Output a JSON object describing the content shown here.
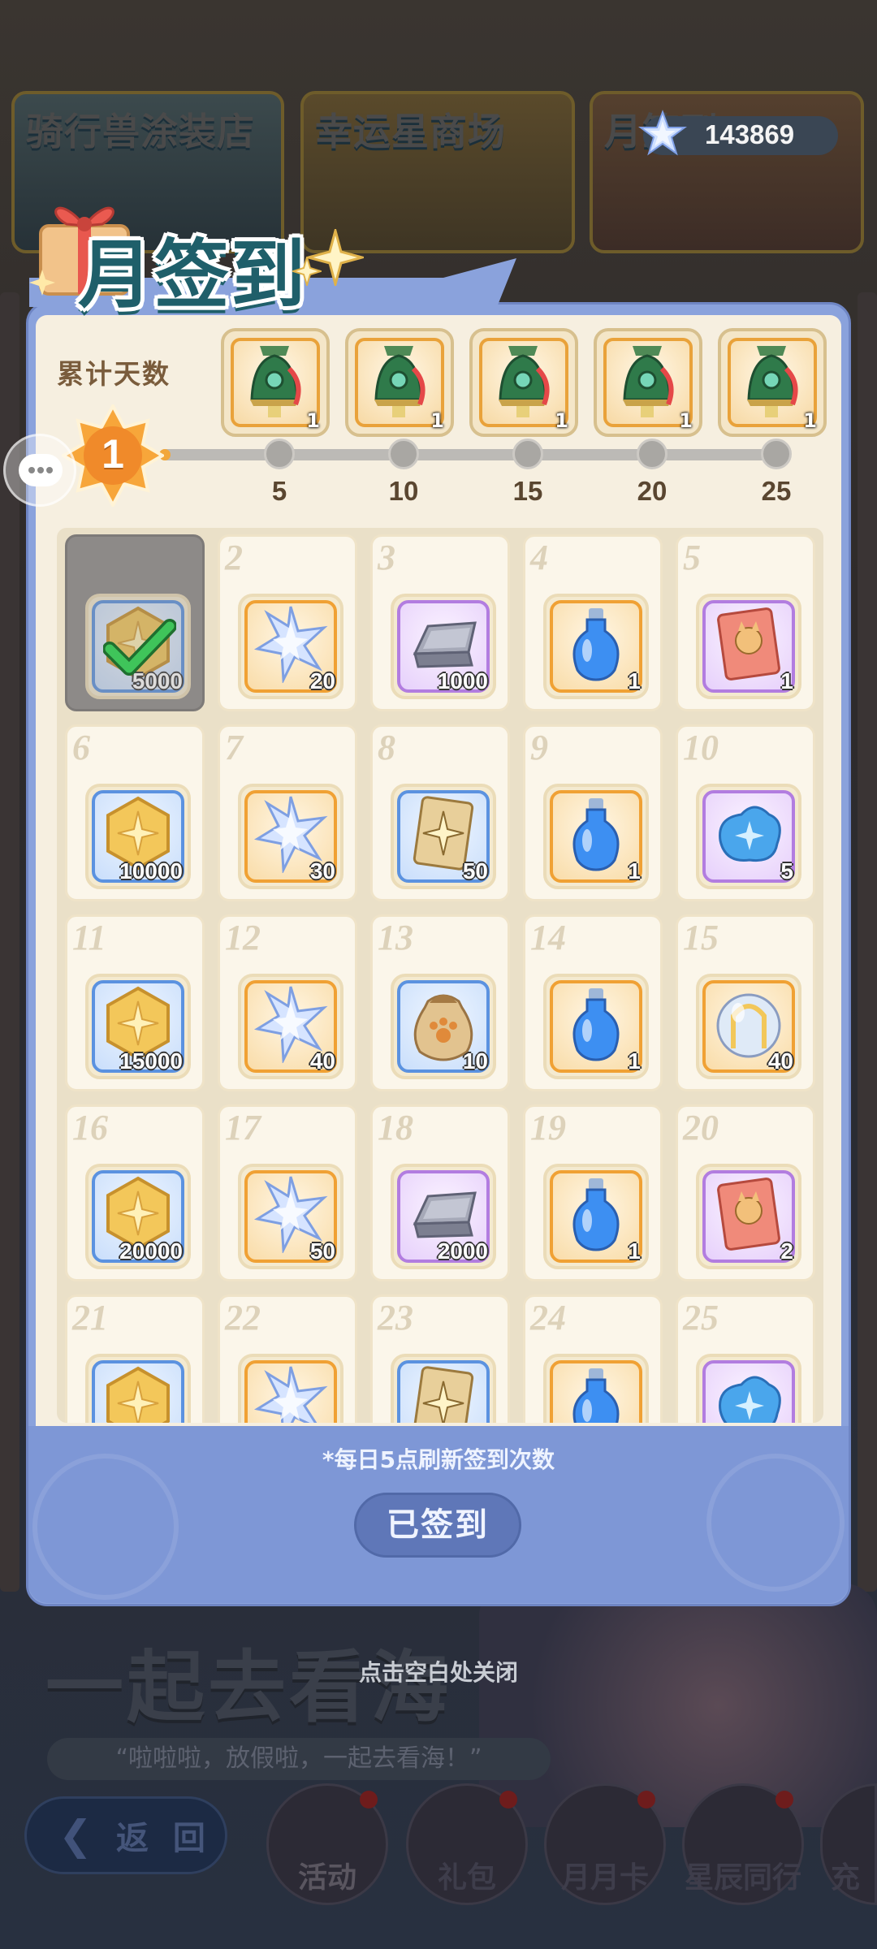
{
  "background": {
    "shops": [
      {
        "label": "骑行兽涂装店"
      },
      {
        "label": "幸运星商场"
      },
      {
        "label": "月签到"
      }
    ],
    "currency": {
      "icon": "star-crystal-icon",
      "amount": "143869"
    },
    "banner_title": "一起去看海",
    "banner_subtitle": "“啦啦啦，放假啦，一起去看海！”",
    "back_label": "返 回",
    "nav": [
      {
        "label": "活动"
      },
      {
        "label": "礼包"
      },
      {
        "label": "月月卡"
      },
      {
        "label": "星辰同行"
      },
      {
        "label": "充"
      }
    ]
  },
  "modal": {
    "title": "月签到",
    "cumulative_label": "累计天数",
    "cumulative_days": "1",
    "milestones": [
      {
        "day": "5",
        "reward": "bell-charm-icon",
        "count": "1"
      },
      {
        "day": "10",
        "reward": "bell-charm-icon",
        "count": "1"
      },
      {
        "day": "15",
        "reward": "bell-charm-icon",
        "count": "1"
      },
      {
        "day": "20",
        "reward": "bell-charm-icon",
        "count": "1"
      },
      {
        "day": "25",
        "reward": "bell-charm-icon",
        "count": "1"
      }
    ],
    "days": [
      {
        "day": "",
        "icon": "gold-coin-icon",
        "rarity": "blue",
        "qty": "5000",
        "claimed": true
      },
      {
        "day": "2",
        "icon": "star-crystal-icon",
        "rarity": "gold",
        "qty": "20",
        "claimed": false
      },
      {
        "day": "3",
        "icon": "silver-ingot-icon",
        "rarity": "purple",
        "qty": "1000",
        "claimed": false
      },
      {
        "day": "4",
        "icon": "blue-potion-icon",
        "rarity": "gold",
        "qty": "1",
        "claimed": false
      },
      {
        "day": "5",
        "icon": "cat-ticket-icon",
        "rarity": "purple",
        "qty": "1",
        "claimed": false
      },
      {
        "day": "6",
        "icon": "gold-coin-icon",
        "rarity": "blue",
        "qty": "10000",
        "claimed": false
      },
      {
        "day": "7",
        "icon": "star-crystal-icon",
        "rarity": "gold",
        "qty": "30",
        "claimed": false
      },
      {
        "day": "8",
        "icon": "star-card-icon",
        "rarity": "blue",
        "qty": "50",
        "claimed": false
      },
      {
        "day": "9",
        "icon": "blue-potion-icon",
        "rarity": "gold",
        "qty": "1",
        "claimed": false
      },
      {
        "day": "10",
        "icon": "blue-crystal-cluster-icon",
        "rarity": "purple",
        "qty": "5",
        "claimed": false
      },
      {
        "day": "11",
        "icon": "gold-coin-icon",
        "rarity": "blue",
        "qty": "15000",
        "claimed": false
      },
      {
        "day": "12",
        "icon": "star-crystal-icon",
        "rarity": "gold",
        "qty": "40",
        "claimed": false
      },
      {
        "day": "13",
        "icon": "paw-food-sack-icon",
        "rarity": "blue",
        "qty": "10",
        "claimed": false
      },
      {
        "day": "14",
        "icon": "blue-potion-icon",
        "rarity": "gold",
        "qty": "1",
        "claimed": false
      },
      {
        "day": "15",
        "icon": "crystal-orb-icon",
        "rarity": "gold",
        "qty": "40",
        "claimed": false
      },
      {
        "day": "16",
        "icon": "gold-coin-icon",
        "rarity": "blue",
        "qty": "20000",
        "claimed": false
      },
      {
        "day": "17",
        "icon": "star-crystal-icon",
        "rarity": "gold",
        "qty": "50",
        "claimed": false
      },
      {
        "day": "18",
        "icon": "silver-ingot-icon",
        "rarity": "purple",
        "qty": "2000",
        "claimed": false
      },
      {
        "day": "19",
        "icon": "blue-potion-icon",
        "rarity": "gold",
        "qty": "1",
        "claimed": false
      },
      {
        "day": "20",
        "icon": "cat-ticket-icon",
        "rarity": "purple",
        "qty": "2",
        "claimed": false
      },
      {
        "day": "21",
        "icon": "gold-coin-icon",
        "rarity": "blue",
        "qty": "",
        "claimed": false
      },
      {
        "day": "22",
        "icon": "star-crystal-icon",
        "rarity": "gold",
        "qty": "",
        "claimed": false
      },
      {
        "day": "23",
        "icon": "star-card-icon",
        "rarity": "blue",
        "qty": "",
        "claimed": false
      },
      {
        "day": "24",
        "icon": "blue-potion-icon",
        "rarity": "gold",
        "qty": "",
        "claimed": false
      },
      {
        "day": "25",
        "icon": "blue-crystal-cluster-icon",
        "rarity": "purple",
        "qty": "",
        "claimed": false
      }
    ],
    "refresh_note": "*每日5点刷新签到次数",
    "signed_button": "已签到",
    "close_hint": "点击空白处关闭"
  }
}
